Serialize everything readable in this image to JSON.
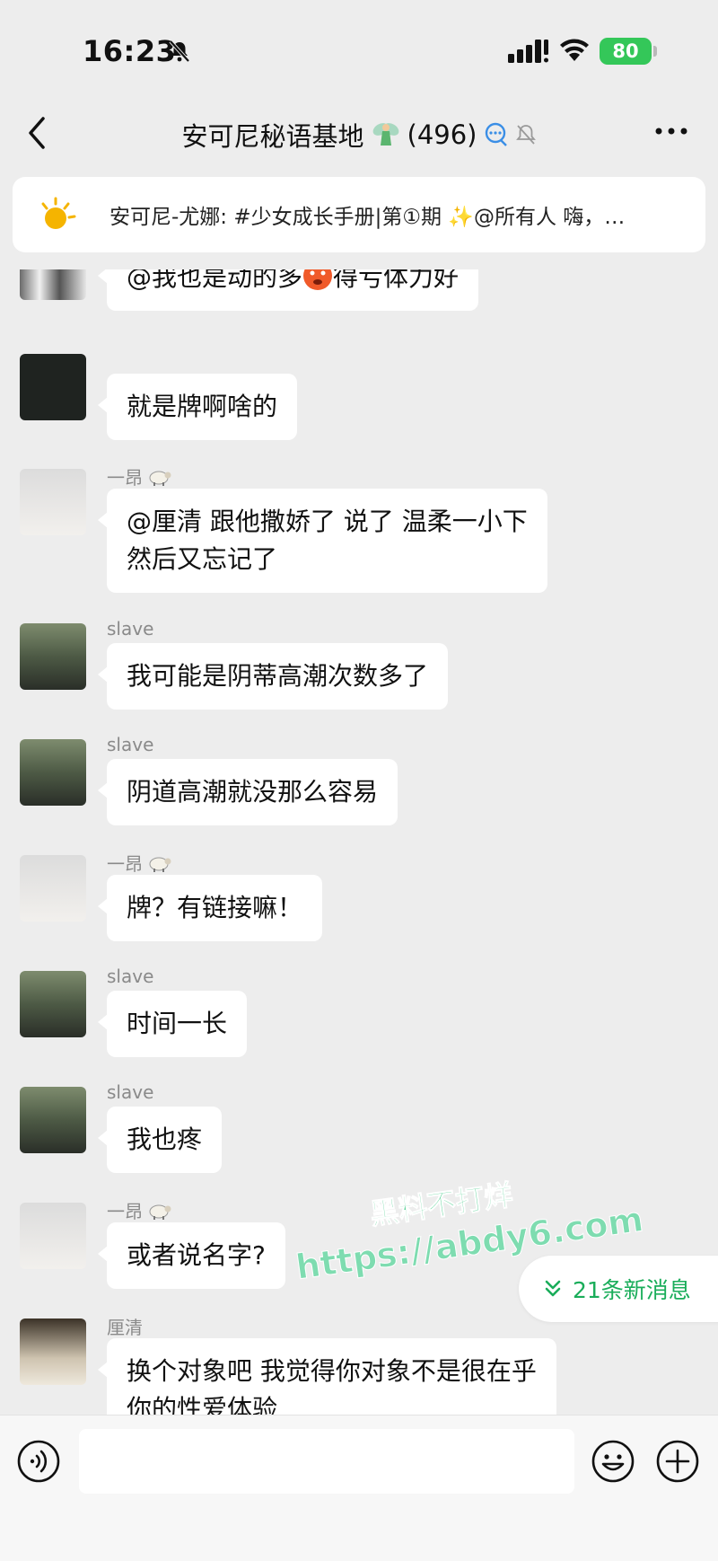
{
  "status_bar": {
    "time": "16:23",
    "battery": "80"
  },
  "header": {
    "title": "安可尼秘语基地",
    "member_count": "(496)"
  },
  "announcement": {
    "text": "安可尼-尤娜: #少女成长手册|第①期 ✨@所有人  嗨，…"
  },
  "messages": [
    {
      "sender": "",
      "text_before": "@我也是动的多",
      "emoji": "hot-face",
      "text_after": "得亏体力好"
    },
    {
      "sender": "",
      "text": "就是牌啊啥的"
    },
    {
      "sender": "一昂",
      "text": "@厘清 跟他撒娇了 说了 温柔一小下\n然后又忘记了"
    },
    {
      "sender": "slave",
      "text": "我可能是阴蒂高潮次数多了"
    },
    {
      "sender": "slave",
      "text": "阴道高潮就没那么容易"
    },
    {
      "sender": "一昂",
      "text": "牌？有链接嘛！"
    },
    {
      "sender": "slave",
      "text": "时间一长"
    },
    {
      "sender": "slave",
      "text": "我也疼"
    },
    {
      "sender": "一昂",
      "text": "或者说名字?"
    },
    {
      "sender": "厘清",
      "text": "换个对象吧 我觉得你对象不是很在乎\n你的性爱体验"
    }
  ],
  "new_messages": {
    "label": "21条新消息"
  },
  "watermark": {
    "line1": "黑料不打烊",
    "line2": "https://abdy6.com"
  },
  "input": {
    "value": "",
    "placeholder": ""
  },
  "colors": {
    "background": "#ededed",
    "bubble": "#ffffff",
    "accent_green": "#1aad5a",
    "battery_green": "#34c759"
  }
}
